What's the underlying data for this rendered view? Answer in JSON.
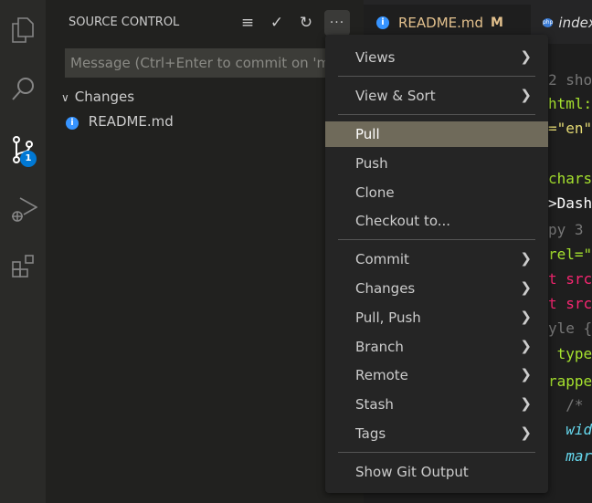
{
  "activity_bar": {
    "items": [
      {
        "icon": "files-icon"
      },
      {
        "icon": "search-icon"
      },
      {
        "icon": "source-control-icon",
        "badge": "1"
      },
      {
        "icon": "run-debug-icon"
      },
      {
        "icon": "extensions-icon"
      }
    ]
  },
  "sidebar": {
    "title": "SOURCE CONTROL",
    "message_placeholder": "Message (Ctrl+Enter to commit on 'main')",
    "changes_label": "Changes",
    "files": [
      {
        "name": "README.md"
      }
    ]
  },
  "tabs": [
    {
      "label": "README.md",
      "status": "M",
      "active": true
    },
    {
      "label": "index.php",
      "icon": "php-icon"
    }
  ],
  "code_fragments": [
    "2 sho",
    "html:",
    "=\"en\"",
    "",
    "chars",
    ">Dash",
    "py 3",
    "rel=\"",
    "t src",
    "t src",
    "yle {",
    " type",
    "rappe",
    "  /*",
    "  wid",
    "  mar"
  ],
  "menu": {
    "items": [
      {
        "label": "Views",
        "submenu": true
      },
      {
        "sep": true
      },
      {
        "label": "View & Sort",
        "submenu": true
      },
      {
        "sep": true
      },
      {
        "label": "Pull",
        "highlighted": true
      },
      {
        "label": "Push"
      },
      {
        "label": "Clone"
      },
      {
        "label": "Checkout to..."
      },
      {
        "sep": true
      },
      {
        "label": "Commit",
        "submenu": true
      },
      {
        "label": "Changes",
        "submenu": true
      },
      {
        "label": "Pull, Push",
        "submenu": true
      },
      {
        "label": "Branch",
        "submenu": true
      },
      {
        "label": "Remote",
        "submenu": true
      },
      {
        "label": "Stash",
        "submenu": true
      },
      {
        "label": "Tags",
        "submenu": true
      },
      {
        "sep": true
      },
      {
        "label": "Show Git Output"
      }
    ]
  },
  "colors": {
    "accent": "#3794ff",
    "highlight": "#6f6a5a",
    "modified": "#e2c08d"
  }
}
